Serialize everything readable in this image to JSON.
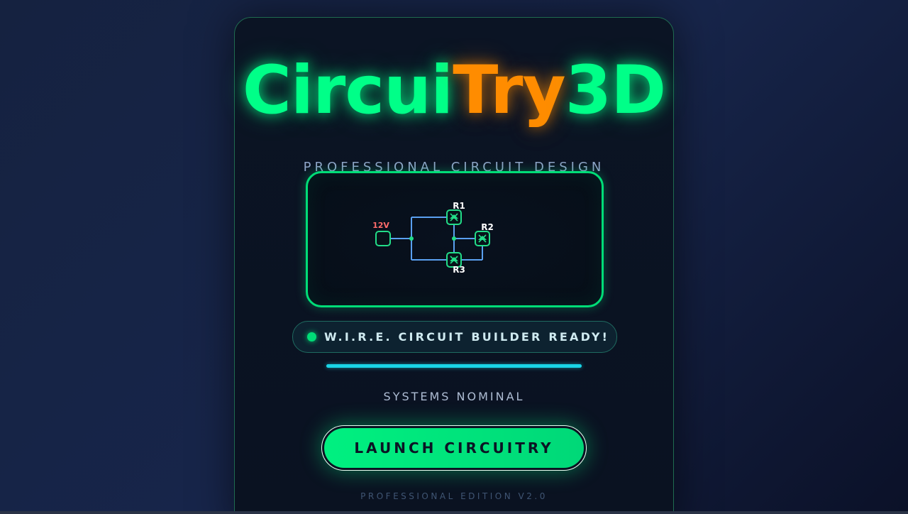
{
  "app": {
    "title_part1": "Circui",
    "title_part2": "Try",
    "title_part3": "3D",
    "subtitle": "PROFESSIONAL CIRCUIT DESIGN"
  },
  "circuit": {
    "source_label": "12V",
    "components": [
      {
        "label": "R1"
      },
      {
        "label": "R2"
      },
      {
        "label": "R3"
      }
    ]
  },
  "status": {
    "text": "W.I.R.E. CIRCUIT BUILDER READY!",
    "progress_percent": 100,
    "system_text": "SYSTEMS NOMINAL"
  },
  "launch": {
    "label": "LAUNCH CIRCUITRY"
  },
  "footer": {
    "edition": "PROFESSIONAL EDITION V2.0"
  },
  "colors": {
    "accent_green": "#00ff88",
    "accent_orange": "#ff8c00",
    "progress_cyan": "#1ad4e6",
    "wire_blue": "#5aa0f0",
    "source_label_red": "#ff6b6b"
  }
}
